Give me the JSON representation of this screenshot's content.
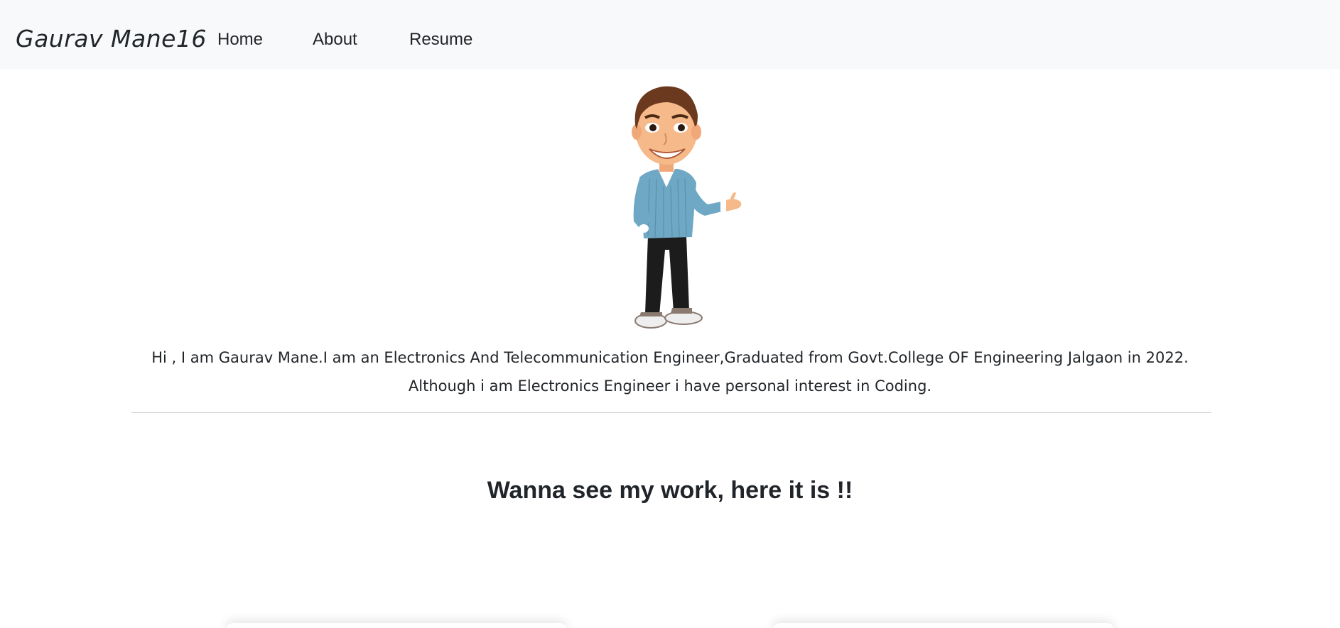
{
  "navbar": {
    "brand": "Gaurav Mane16",
    "links": [
      {
        "label": "Home"
      },
      {
        "label": "About"
      },
      {
        "label": "Resume"
      }
    ]
  },
  "hero": {
    "avatar_icon": "cartoon-man-presenting-illustration",
    "intro_line_1": "Hi , I am Gaurav Mane.I am an Electronics And Telecommunication Engineer,Graduated from Govt.College OF Engineering Jalgaon in 2022.",
    "intro_line_2": "Although i am Electronics Engineer i have personal interest in Coding."
  },
  "work": {
    "heading": "Wanna see my work, here it is !!"
  },
  "colors": {
    "navbar_bg": "#f8f9fa",
    "text": "#212529",
    "shirt": "#6fa8c4",
    "pants": "#1c1c1c",
    "hair": "#6b3a1e",
    "skin": "#f5b98a"
  }
}
